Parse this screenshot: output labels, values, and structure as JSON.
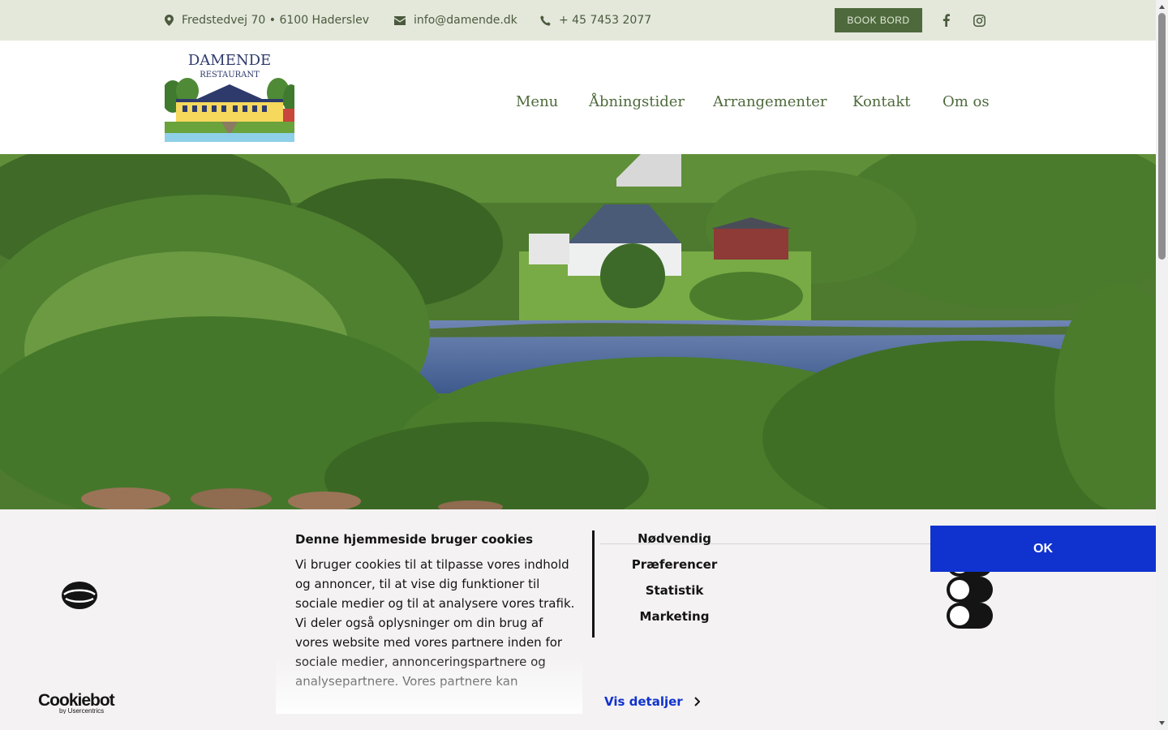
{
  "topbar": {
    "address": "Fredstedvej 70 • 6100 Haderslev",
    "email": "info@damende.dk",
    "phone": "+ 45 7453 2077",
    "book_label": "BOOK BORD",
    "social_icons": [
      "facebook-icon",
      "instagram-icon"
    ]
  },
  "logo": {
    "line1": "DAMENDE",
    "line2": "RESTAURANT"
  },
  "nav": {
    "items": [
      "Menu",
      "Åbningstider",
      "Arrangementer",
      "Kontakt",
      "Om os"
    ]
  },
  "cookie": {
    "title": "Denne hjemmeside bruger cookies",
    "text": "Vi bruger cookies til at tilpasse vores indhold og annoncer, til at vise dig funktioner til sociale medier og til at analysere vores trafik. Vi deler også oplysninger om din brug af vores website med vores partnere inden for sociale medier, annonceringspartnere og analysepartnere. Vores partnere kan",
    "categories": [
      "Nødvendig",
      "Præferencer",
      "Statistik",
      "Marketing"
    ],
    "ok_label": "OK",
    "details_label": "Vis detaljer",
    "brand_name": "Cookiebot",
    "brand_sub": "by Usercentrics"
  },
  "colors": {
    "topbar_bg": "#e3e8db",
    "brand_green": "#4e6a3c",
    "cookie_blue": "#1032cf",
    "cookie_bg": "#f4f2f2"
  }
}
